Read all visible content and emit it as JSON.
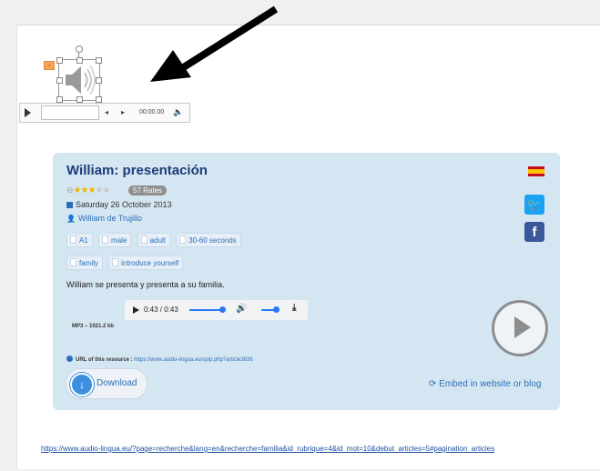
{
  "slide_object": {
    "mini_player_time": "00:00.00"
  },
  "card": {
    "title": "William: presentación",
    "rating_stars": 3,
    "rating_max": 5,
    "rates_label": "57 Rates",
    "date": "Saturday 26 October 2013",
    "author": "William de Trujillo",
    "tags_row1": [
      "A1",
      "male",
      "adult",
      "30-60 seconds"
    ],
    "tags_row2": [
      "family",
      "introduce yourself"
    ],
    "description": "William se presenta y presenta a su familia.",
    "audio_time": "0:43 / 0:43",
    "file_info": "MP3 – 1021.2 kb",
    "url_label": "URL of this resource :",
    "url_value": "https://www.audio-lingua.eu/spip.php?article3636",
    "download_label": "Download",
    "embed_label": "Embed in website or blog"
  },
  "footer_link": "https://www.audio-lingua.eu/?page=recherche&lang=en&recherche=familia&id_rubrique=4&id_mot=10&debut_articles=5#pagination_articles",
  "colors": {
    "card_bg": "#d5e6f3",
    "link": "#2d6fb5",
    "title": "#1d3c78"
  }
}
